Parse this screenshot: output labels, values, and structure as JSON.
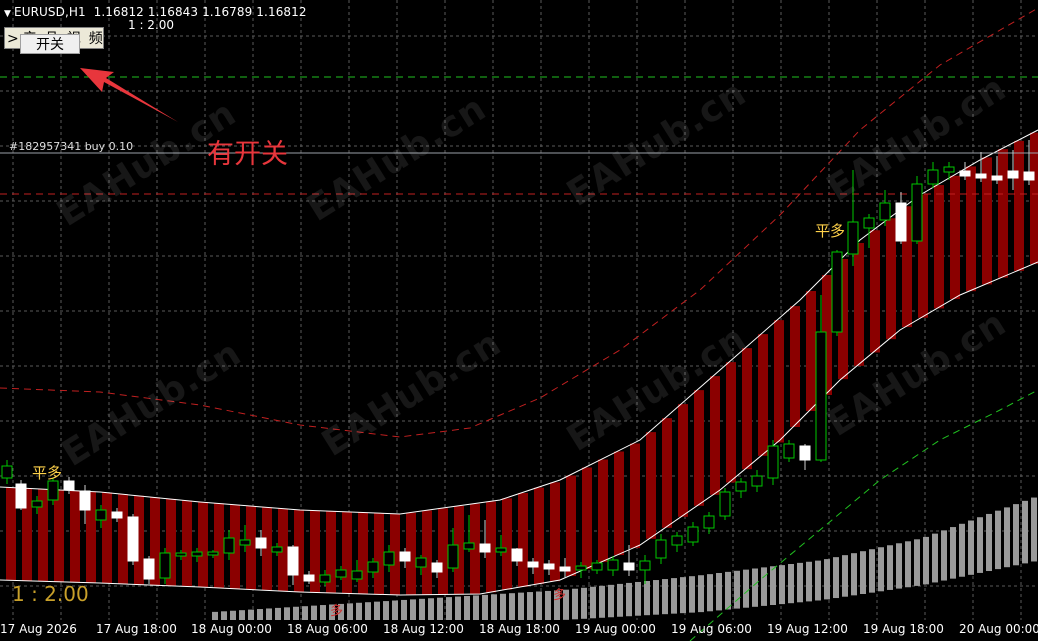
{
  "header": {
    "symbol_timeframe": "EURUSD,H1",
    "ohlc": "1.16812 1.16843 1.16789 1.16812",
    "small_ratio": "1 : 2.00"
  },
  "indicator_panel": {
    "prefix": ">",
    "label": "产品视频",
    "toggle_label": "开关"
  },
  "annotation_text": "有开关",
  "order_line": "#182957341 buy 0.10",
  "signals": [
    "平多",
    "平多",
    "多",
    "多"
  ],
  "big_ratio": "1 : 2.00",
  "watermark": "EAHub.cn",
  "x_axis_labels": [
    "17 Aug 2026",
    "17 Aug 18:00",
    "18 Aug 00:00",
    "18 Aug 06:00",
    "18 Aug 12:00",
    "18 Aug 18:00",
    "19 Aug 00:00",
    "19 Aug 06:00",
    "19 Aug 12:00",
    "19 Aug 18:00",
    "20 Aug 00:00"
  ],
  "colors": {
    "background": "#000000",
    "bull_candle": "#00c800",
    "bear_candle": "#ffffff",
    "channel_fill": "#8b0000",
    "dashed_red": "#c02020",
    "dashed_green": "#20c020",
    "annotation": "#e8363c",
    "signal": "#ffd24a",
    "lower_band": "#9a9a9a"
  }
}
